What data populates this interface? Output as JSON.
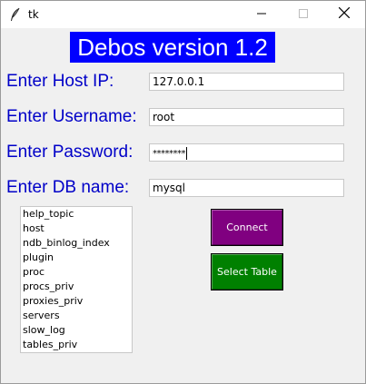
{
  "window": {
    "title": "tk",
    "icon": "tk-feather-icon",
    "controls": [
      "minimize-icon",
      "maximize-icon",
      "close-icon"
    ]
  },
  "heading": "Debos version 1.2",
  "form": {
    "host_label": "Enter Host IP:",
    "host_value": "127.0.0.1",
    "username_label": "Enter Username:",
    "username_value": "root",
    "password_label": "Enter Password:",
    "password_value": "********",
    "db_label": "Enter DB name:",
    "db_value": "mysql"
  },
  "tables_list": {
    "items": [
      "help_topic",
      "host",
      "ndb_binlog_index",
      "plugin",
      "proc",
      "procs_priv",
      "proxies_priv",
      "servers",
      "slow_log",
      "tables_priv"
    ]
  },
  "buttons": {
    "connect_label": "Connect",
    "select_label": "Select Table"
  },
  "colors": {
    "heading_bg": "#0000ff",
    "label_text": "#0000c8",
    "connect_bg": "#800080",
    "select_bg": "#008000"
  }
}
